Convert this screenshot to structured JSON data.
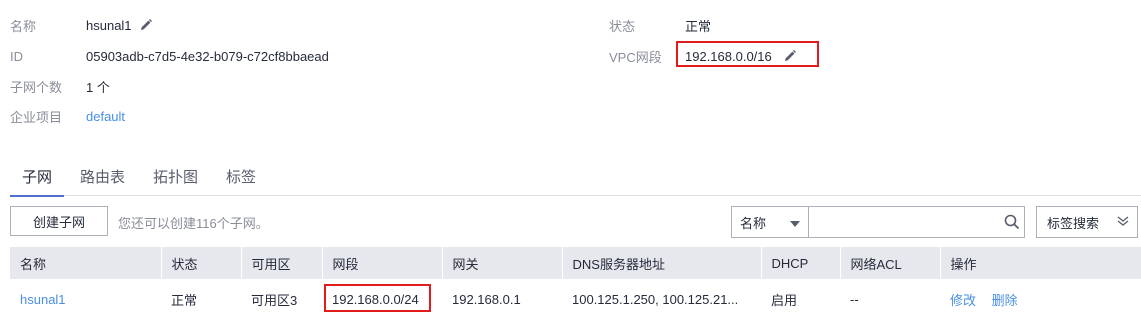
{
  "details": {
    "name_label": "名称",
    "name_value": "hsunal1",
    "id_label": "ID",
    "id_value": "05903adb-c7d5-4e32-b079-c72cf8bbaead",
    "subnet_count_label": "子网个数",
    "subnet_count_value": "1 个",
    "project_label": "企业项目",
    "project_value": "default",
    "status_label": "状态",
    "status_value": "正常",
    "cidr_label": "VPC网段",
    "cidr_value": "192.168.0.0/16"
  },
  "tabs": [
    {
      "label": "子网"
    },
    {
      "label": "路由表"
    },
    {
      "label": "拓扑图"
    },
    {
      "label": "标签"
    }
  ],
  "toolbar": {
    "create_label": "创建子网",
    "hint": "您还可以创建116个子网。",
    "filter_select": "名称",
    "search_placeholder": "",
    "tag_search_label": "标签搜索"
  },
  "table": {
    "headers": [
      "名称",
      "状态",
      "可用区",
      "网段",
      "网关",
      "DNS服务器地址",
      "DHCP",
      "网络ACL",
      "操作"
    ],
    "rows": [
      {
        "name": "hsunal1",
        "status": "正常",
        "az": "可用区3",
        "cidr": "192.168.0.0/24",
        "gateway": "192.168.0.1",
        "dns": "100.125.1.250, 100.125.21...",
        "dhcp": "启用",
        "acl": "--",
        "action_modify": "修改",
        "action_delete": "删除"
      }
    ]
  },
  "colors": {
    "link": "#4a8ee6",
    "highlight": "#e21b1b",
    "tab_indicator": "#526ecc",
    "header_bg": "#e6e8ed"
  }
}
